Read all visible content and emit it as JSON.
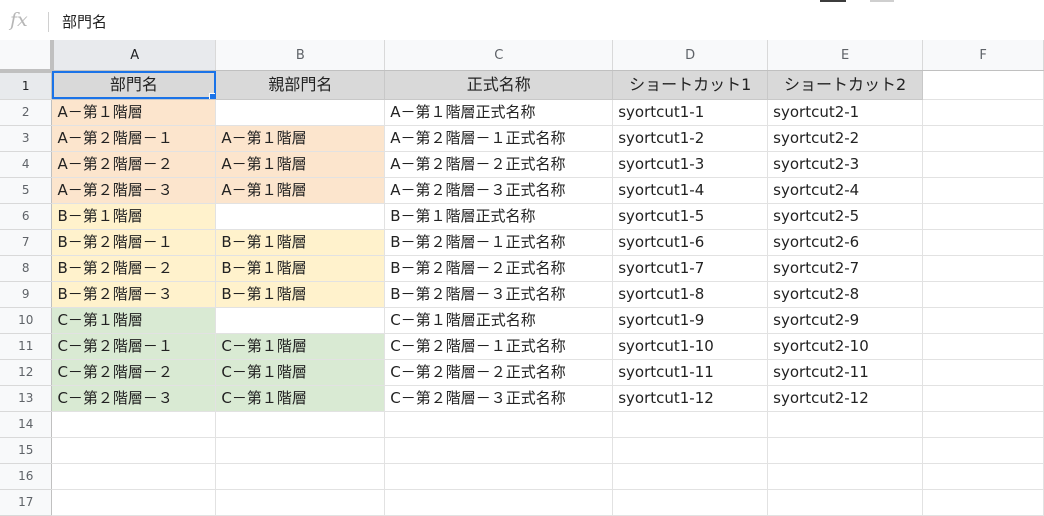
{
  "formula_bar": {
    "fx_label": "fx",
    "value": "部門名"
  },
  "columns": [
    "A",
    "B",
    "C",
    "D",
    "E",
    "F"
  ],
  "rows": [
    [
      "部門名",
      "親部門名",
      "正式名称",
      "ショートカット1",
      "ショートカット2",
      ""
    ],
    [
      "A－第１階層",
      "",
      "A－第１階層正式名称",
      "syortcut1-1",
      "syortcut2-1",
      ""
    ],
    [
      "A－第２階層－１",
      "A－第１階層",
      "A－第２階層－１正式名称",
      "syortcut1-2",
      "syortcut2-2",
      ""
    ],
    [
      "A－第２階層－２",
      "A－第１階層",
      "A－第２階層－２正式名称",
      "syortcut1-3",
      "syortcut2-3",
      ""
    ],
    [
      "A－第２階層－３",
      "A－第１階層",
      "A－第２階層－３正式名称",
      "syortcut1-4",
      "syortcut2-4",
      ""
    ],
    [
      "B－第１階層",
      "",
      "B－第１階層正式名称",
      "syortcut1-5",
      "syortcut2-5",
      ""
    ],
    [
      "B－第２階層－１",
      "B－第１階層",
      "B－第２階層－１正式名称",
      "syortcut1-6",
      "syortcut2-6",
      ""
    ],
    [
      "B－第２階層－２",
      "B－第１階層",
      "B－第２階層－２正式名称",
      "syortcut1-7",
      "syortcut2-7",
      ""
    ],
    [
      "B－第２階層－３",
      "B－第１階層",
      "B－第２階層－３正式名称",
      "syortcut1-8",
      "syortcut2-8",
      ""
    ],
    [
      "C－第１階層",
      "",
      "C－第１階層正式名称",
      "syortcut1-9",
      "syortcut2-9",
      ""
    ],
    [
      "C－第２階層－１",
      "C－第１階層",
      "C－第２階層－１正式名称",
      "syortcut1-10",
      "syortcut2-10",
      ""
    ],
    [
      "C－第２階層－２",
      "C－第１階層",
      "C－第２階層－２正式名称",
      "syortcut1-11",
      "syortcut2-11",
      ""
    ],
    [
      "C－第２階層－３",
      "C－第１階層",
      "C－第２階層－３正式名称",
      "syortcut1-12",
      "syortcut2-12",
      ""
    ],
    [
      "",
      "",
      "",
      "",
      "",
      ""
    ],
    [
      "",
      "",
      "",
      "",
      "",
      ""
    ],
    [
      "",
      "",
      "",
      "",
      "",
      ""
    ],
    [
      "",
      "",
      "",
      "",
      "",
      ""
    ]
  ],
  "selection": {
    "cell": "A1"
  },
  "colors": {
    "header_fill": "#d9d9d9",
    "group_a_fill": "#fce5cd",
    "group_b_fill": "#fff2cc",
    "group_c_fill": "#d9ead3",
    "selection_accent": "#1a73e8"
  }
}
